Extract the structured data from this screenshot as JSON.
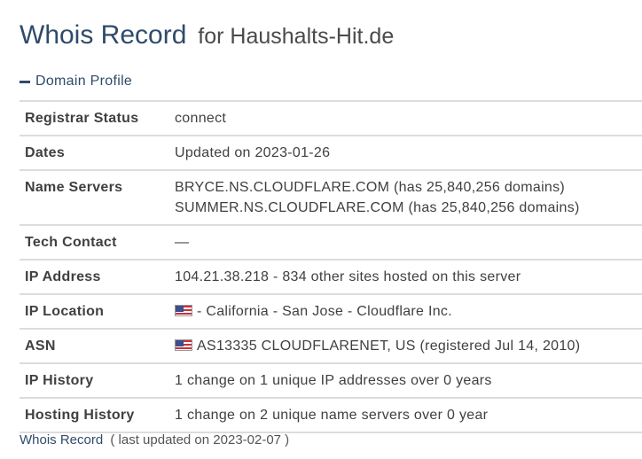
{
  "title": {
    "main": "Whois Record",
    "sub": "for Haushalts-Hit.de"
  },
  "section": {
    "label": "Domain Profile"
  },
  "rows": {
    "registrar_status": {
      "label": "Registrar Status",
      "value": "connect"
    },
    "dates": {
      "label": "Dates",
      "value": "Updated on 2023-01-26"
    },
    "name_servers": {
      "label": "Name Servers",
      "line1": "BRYCE.NS.CLOUDFLARE.COM (has 25,840,256 domains)",
      "line2": "SUMMER.NS.CLOUDFLARE.COM (has 25,840,256 domains)"
    },
    "tech_contact": {
      "label": "Tech Contact",
      "value": "—"
    },
    "ip_address": {
      "label": "IP Address",
      "value": "104.21.38.218 - 834 other sites hosted on this server"
    },
    "ip_location": {
      "label": "IP Location",
      "value": "- California - San Jose - Cloudflare Inc.",
      "flag_icon": "us-flag-icon"
    },
    "asn": {
      "label": "ASN",
      "value": "AS13335 CLOUDFLARENET, US (registered Jul 14, 2010)",
      "flag_icon": "us-flag-icon"
    },
    "ip_history": {
      "label": "IP History",
      "value": "1 change on 1 unique IP addresses over 0 years"
    },
    "hosting_history": {
      "label": "Hosting History",
      "value": "1 change on 2 unique name servers over 0 year"
    }
  },
  "footer": {
    "link": "Whois Record",
    "note": "( last updated on 2023-02-07 )"
  },
  "colors": {
    "heading": "#2f4b6b",
    "divider": "#dcdcdc",
    "text": "#404040"
  }
}
